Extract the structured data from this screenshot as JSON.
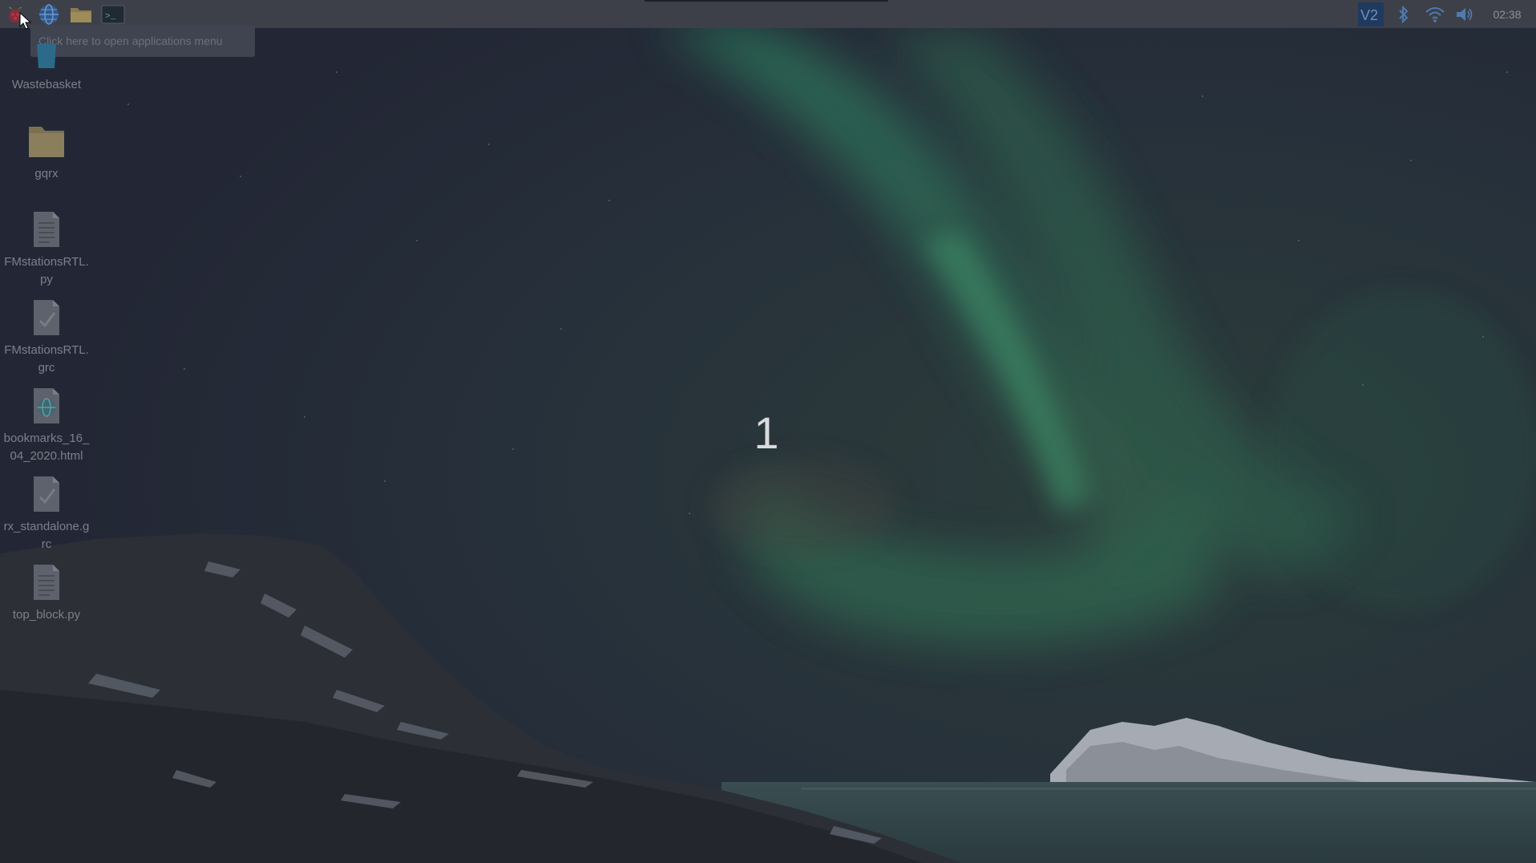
{
  "taskbar": {
    "launchers": [
      {
        "icon": "raspberry-menu-icon"
      },
      {
        "icon": "web-browser-globe-icon"
      },
      {
        "icon": "file-manager-folder-icon"
      },
      {
        "icon": "terminal-icon",
        "glyph": ">_"
      }
    ],
    "tray": {
      "vnc_label": "V2",
      "bluetooth_icon": "bluetooth-icon",
      "wifi_icon": "wifi-icon",
      "volume_icon": "volume-icon",
      "clock": "02:38"
    }
  },
  "tooltip": {
    "text": "Click here to open applications menu"
  },
  "desktop": {
    "icons": [
      {
        "label": "Wastebasket",
        "icon": "trash-icon"
      },
      {
        "label": "gqrx",
        "icon": "folder-icon"
      },
      {
        "label": "FMstationsRTL.py",
        "icon": "text-file-icon"
      },
      {
        "label": "FMstationsRTL.grc",
        "icon": "grc-file-icon"
      },
      {
        "label": "bookmarks_16_04_2020.html",
        "icon": "html-file-icon"
      },
      {
        "label": "rx_standalone.grc",
        "icon": "grc-file-icon"
      },
      {
        "label": "top_block.py",
        "icon": "text-file-icon"
      }
    ],
    "workspace_number": "1"
  },
  "colors": {
    "taskbar": "#3d4049",
    "sky": "#262a37",
    "aurora": "#2e6b55",
    "tooltip_bg": "#404451",
    "label_text": "#7b808a"
  }
}
